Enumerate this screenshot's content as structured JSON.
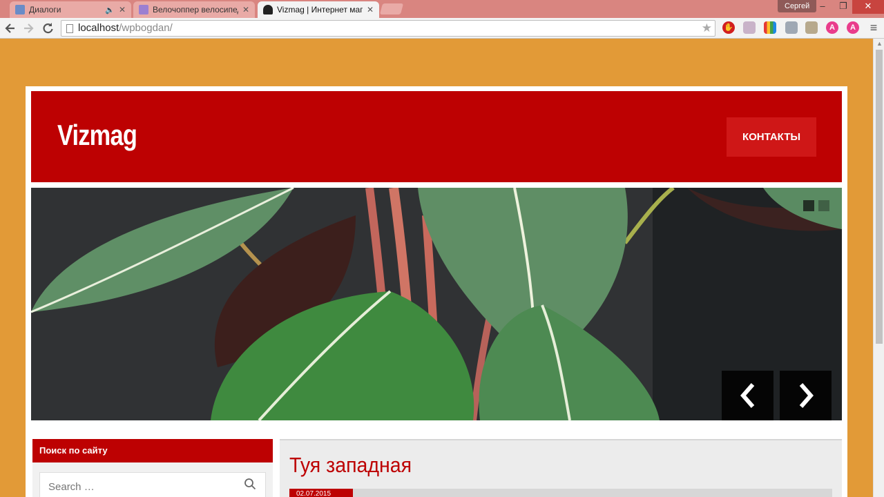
{
  "browser": {
    "tabs": [
      {
        "label": "Диалоги",
        "active": false
      },
      {
        "label": "Велочоппер велосипед д",
        "active": false
      },
      {
        "label": "Vizmag | Интернет магаз",
        "active": true
      }
    ],
    "user_name": "Сергей",
    "address": {
      "host": "localhost",
      "path": "/wpbogdan/"
    },
    "window_controls": {
      "minimize": "–",
      "maximize": "❐",
      "close": "✕"
    },
    "colors": {
      "tabbar": "#d98580",
      "toolbar": "#f3f3f3"
    }
  },
  "site": {
    "title": "Vizmag",
    "nav": [
      {
        "label": "КОНТАКТЫ"
      }
    ],
    "colors": {
      "primary": "#bd0102",
      "background": "#e29a37"
    }
  },
  "slider": {
    "prev_label": "‹",
    "next_label": "›",
    "slide_count": 2,
    "active_slide": 2
  },
  "sidebar": {
    "search_widget": {
      "title": "Поиск по сайту",
      "placeholder": "Search …"
    }
  },
  "post": {
    "title": "Туя западная",
    "date": "02.07.2015"
  }
}
